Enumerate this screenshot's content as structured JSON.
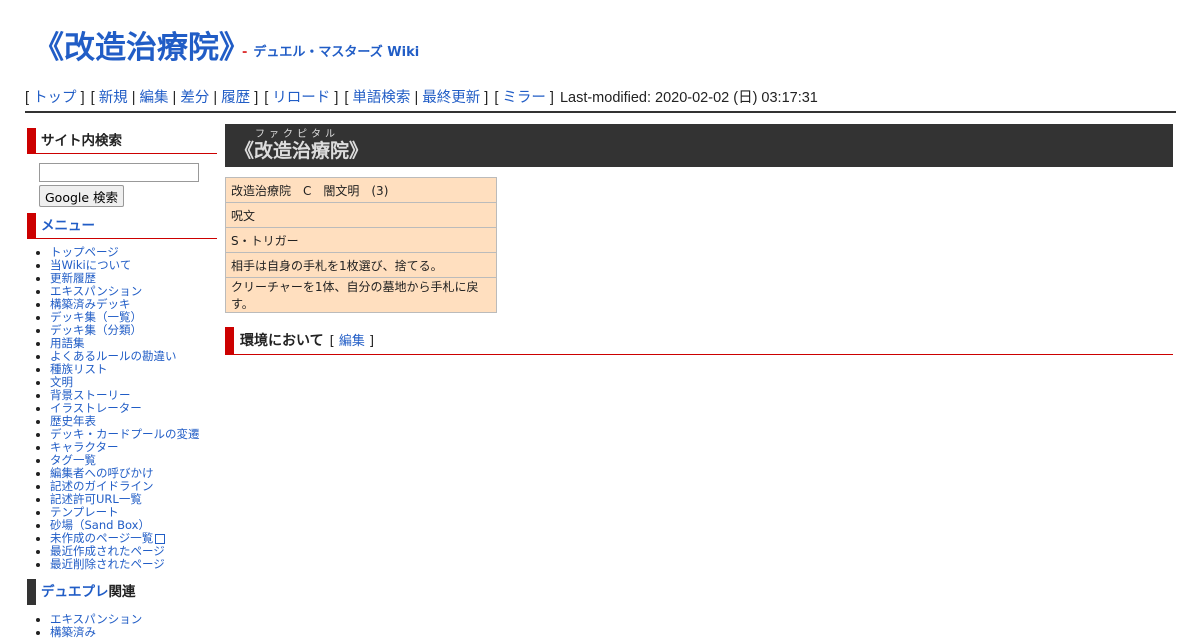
{
  "site": {
    "title": "《改造治療院》",
    "sub_dash": "-",
    "sub_link": "デュエル・マスターズ Wiki"
  },
  "toolbar": {
    "top": "トップ",
    "new": "新規",
    "edit": "編集",
    "diff": "差分",
    "history": "履歴",
    "reload": "リロード",
    "word_search": "単語検索",
    "recent": "最終更新",
    "mirror": "ミラー",
    "last_modified": "Last-modified: 2020-02-02 (日) 03:17:31"
  },
  "sidebar": {
    "search_heading": "サイト内検索",
    "search_button": "Google 検索",
    "menu_heading": "メニュー",
    "menu_items": [
      "トップページ",
      "当Wikiについて",
      "更新履歴",
      "エキスパンション",
      "構築済みデッキ",
      "デッキ集（一覧）",
      "デッキ集（分類）",
      "用語集",
      "よくあるルールの勘違い",
      "種族リスト",
      "文明",
      "背景ストーリー",
      "イラストレーター",
      "歴史年表",
      "デッキ・カードプールの変遷",
      "キャラクター",
      "タグ一覧",
      "編集者への呼びかけ",
      "記述のガイドライン",
      "記述許可URL一覧",
      "テンプレート",
      "砂場（Sand Box）",
      "未作成のページ一覧",
      "最近作成されたページ",
      "最近削除されたページ"
    ],
    "dp_heading_link": "デュエプレ",
    "dp_heading_text": "関連",
    "dp_items": [
      "エキスパンション",
      "構築済み"
    ]
  },
  "main": {
    "title": "《改造治療院》",
    "ruby": "ファクピタル",
    "card_rows": [
      "改造治療院　C　闇文明　(3)",
      "呪文",
      "S・トリガー",
      "相手は自身の手札を1枚選び、捨てる。",
      "クリーチャーを1体、自分の墓地から手札に戻す。"
    ],
    "env_heading": "環境において",
    "env_edit": "編集"
  },
  "colors": {
    "link": "#215dc6",
    "accent_red": "#cc0000",
    "title_bar": "#333333",
    "card_bg": "#ffdfbf"
  }
}
